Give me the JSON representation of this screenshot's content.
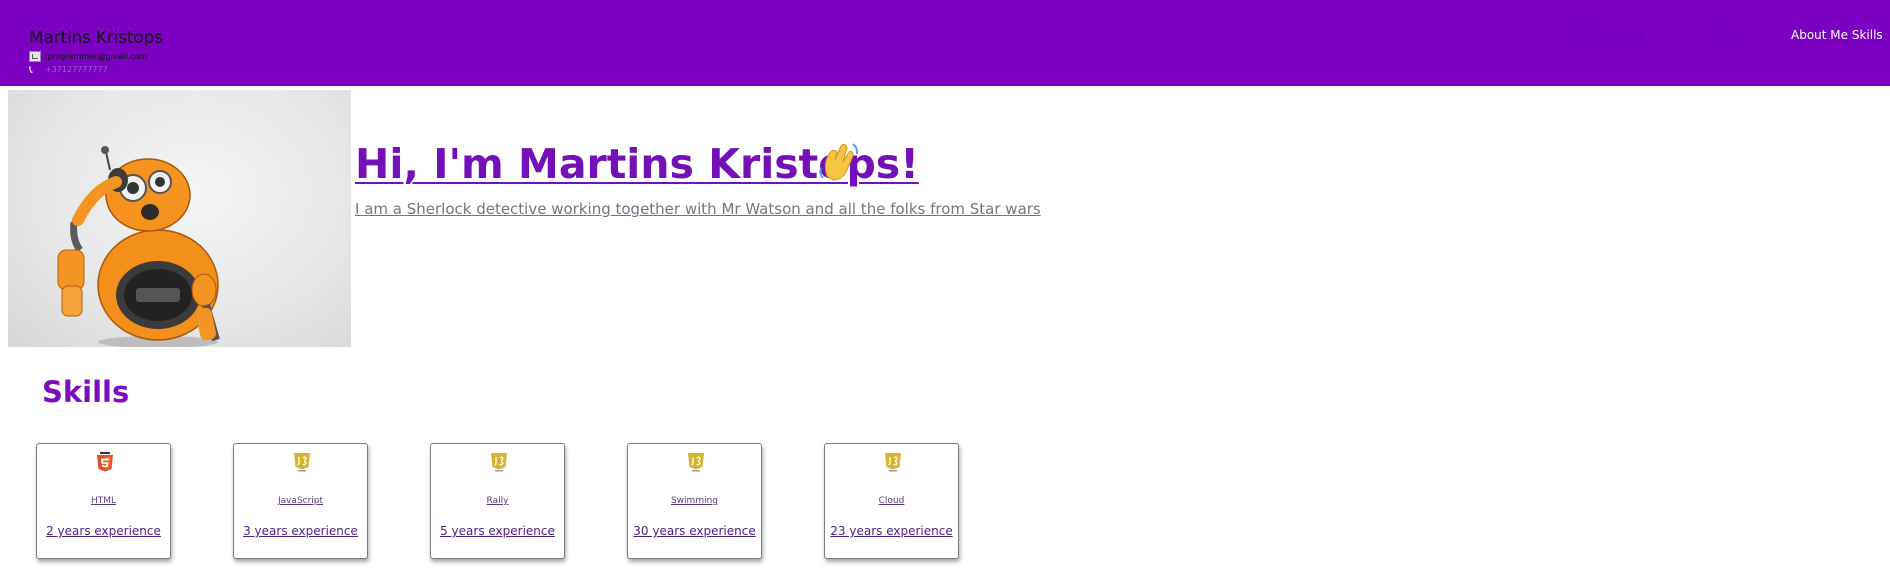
{
  "header": {
    "name": "Martins Kristops",
    "email": "jprogrammer@gmail.com",
    "phone": "+37127777777",
    "nav": [
      {
        "label": "Testimonials"
      },
      {
        "label": "Blog"
      },
      {
        "label": "About Me Skills"
      }
    ]
  },
  "hero": {
    "title": "Hi, I'm Martins Kristops! ",
    "subtitle": "I am a Sherlock detective working together with Mr Watson and all the folks from Star wars",
    "image": "orange-robot-image",
    "wave_icon": "waving-hand-icon"
  },
  "skills": {
    "heading": "Skills",
    "cards": [
      {
        "name": "HTML",
        "experience": "2 years experience",
        "icon": "html5-icon",
        "color": "#e44d26"
      },
      {
        "name": "JavaScript",
        "experience": "3 years experience",
        "icon": "js-icon",
        "color": "#d4b430"
      },
      {
        "name": "Rally",
        "experience": "5 years experience",
        "icon": "js-icon",
        "color": "#d4b430"
      },
      {
        "name": "Swimming",
        "experience": "30 years experience",
        "icon": "js-icon",
        "color": "#d4b430"
      },
      {
        "name": "Cloud",
        "experience": "23 years experience",
        "icon": "js-icon",
        "color": "#d4b430"
      }
    ]
  },
  "colors": {
    "header_bg": "#7b00c2",
    "accent": "#7310b8"
  }
}
